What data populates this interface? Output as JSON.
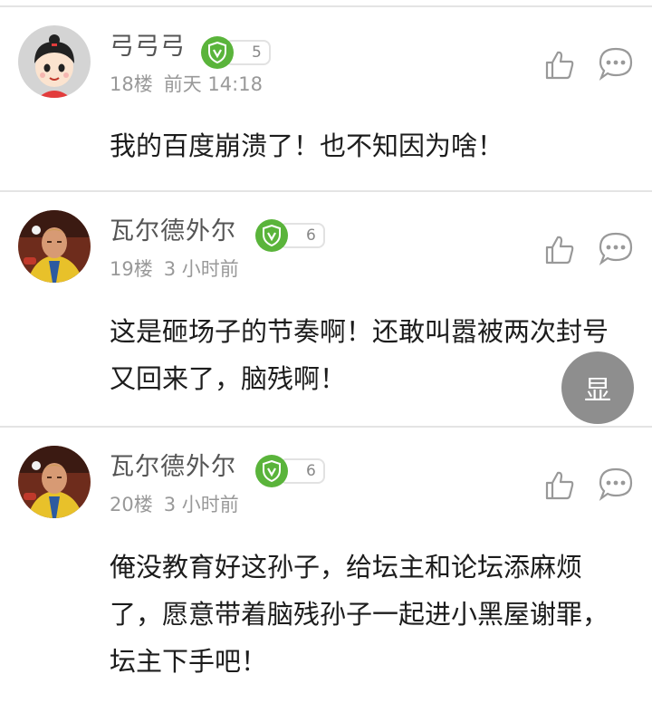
{
  "posts": [
    {
      "username": "弓弓弓",
      "level": "5",
      "floor": "18楼",
      "time": "前天 14:18",
      "content": "我的百度崩溃了！也不知因为啥！"
    },
    {
      "username": "瓦尔德外尔",
      "level": "6",
      "floor": "19楼",
      "time": "3 小时前",
      "content": "这是砸场子的节奏啊！还敢叫嚣被两次封号又回来了，脑残啊！"
    },
    {
      "username": "瓦尔德外尔",
      "level": "6",
      "floor": "20楼",
      "time": "3 小时前",
      "content": "俺没教育好这孙子，给坛主和论坛添麻烦了，愿意带着脑残孙子一起进小黑屋谢罪，坛主下手吧！"
    }
  ],
  "float_button": {
    "label": "显"
  },
  "colors": {
    "badge_green": "#5ab43b",
    "meta_gray": "#999999",
    "float_gray": "#888888"
  }
}
